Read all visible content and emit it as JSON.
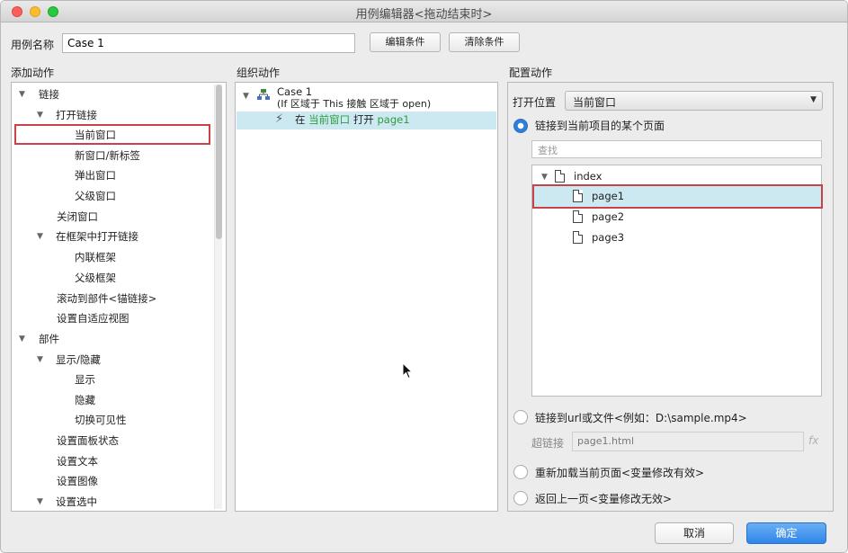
{
  "window": {
    "title": "用例编辑器<拖动结束时>"
  },
  "case_name": {
    "label": "用例名称",
    "value": "Case 1"
  },
  "buttons": {
    "edit_condition": "编辑条件",
    "clear_condition": "清除条件",
    "cancel": "取消",
    "ok": "确定"
  },
  "add_actions": {
    "header": "添加动作",
    "items": [
      {
        "label": "链接",
        "arrow": "▼"
      },
      {
        "label": "打开链接",
        "arrow": "▼"
      },
      {
        "label": "当前窗口"
      },
      {
        "label": "新窗口/新标签"
      },
      {
        "label": "弹出窗口"
      },
      {
        "label": "父级窗口"
      },
      {
        "label": "关闭窗口"
      },
      {
        "label": "在框架中打开链接",
        "arrow": "▼"
      },
      {
        "label": "内联框架"
      },
      {
        "label": "父级框架"
      },
      {
        "label": "滚动到部件<锚链接>"
      },
      {
        "label": "设置自适应视图"
      },
      {
        "label": "部件",
        "arrow": "▼"
      },
      {
        "label": "显示/隐藏",
        "arrow": "▼"
      },
      {
        "label": "显示"
      },
      {
        "label": "隐藏"
      },
      {
        "label": "切换可见性"
      },
      {
        "label": "设置面板状态"
      },
      {
        "label": "设置文本"
      },
      {
        "label": "设置图像"
      },
      {
        "label": "设置选中",
        "arrow": "▼"
      }
    ]
  },
  "organize_actions": {
    "header": "组织动作",
    "case_title": "Case 1",
    "case_condition": "(If 区域于 This 接触 区域于 open)",
    "action": {
      "prefix": "在",
      "target": "当前窗口",
      "verb": "打开",
      "page": "page1"
    }
  },
  "configure_actions": {
    "header": "配置动作",
    "open_in_label": "打开位置",
    "open_in_value": "当前窗口",
    "option_page": "链接到当前项目的某个页面",
    "search_placeholder": "查找",
    "pages": {
      "root": "index",
      "children": [
        "page1",
        "page2",
        "page3"
      ]
    },
    "option_url": "链接到url或文件<例如：D:\\sample.mp4>",
    "hyperlink_label": "超链接",
    "hyperlink_value": "page1.html",
    "fx": "fx",
    "option_reload": "重新加载当前页面<变量修改有效>",
    "option_back": "返回上一页<变量修改无效>"
  }
}
